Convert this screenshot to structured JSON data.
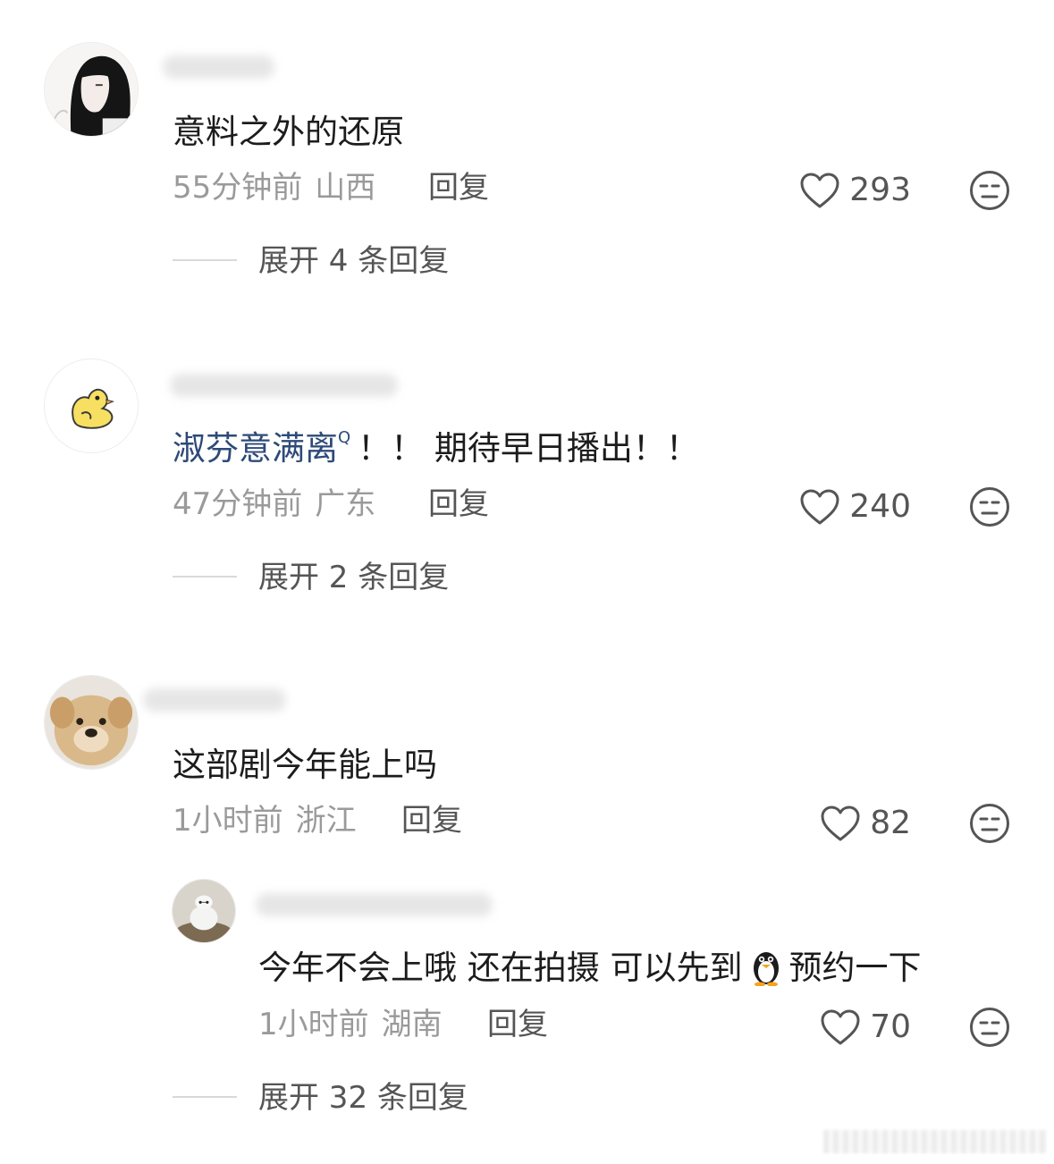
{
  "comments": [
    {
      "text": "意料之外的还原",
      "time": "55分钟前",
      "location": "山西",
      "reply_label": "回复",
      "likes": "293",
      "expand_label": "展开 4 条回复"
    },
    {
      "mention": "淑芬意满离",
      "text": "！！ 期待早日播出！！",
      "time": "47分钟前",
      "location": "广东",
      "reply_label": "回复",
      "likes": "240",
      "expand_label": "展开 2 条回复"
    },
    {
      "text": "这部剧今年能上吗",
      "time": "1小时前",
      "location": "浙江",
      "reply_label": "回复",
      "likes": "82",
      "expand_label": "展开 32 条回复",
      "reply": {
        "text_before": "今年不会上哦 还在拍摄 可以先到",
        "text_after": "预约一下",
        "time": "1小时前",
        "location": "湖南",
        "reply_label": "回复",
        "likes": "70"
      }
    }
  ],
  "colors": {
    "mention": "#2d4a78",
    "meta": "#9a9a9a",
    "action": "#555555",
    "text": "#1c1c1c"
  },
  "icons": {
    "like": "heart-outline-icon",
    "dislike": "neutral-face-icon",
    "penguin": "penguin-emoji-icon"
  }
}
